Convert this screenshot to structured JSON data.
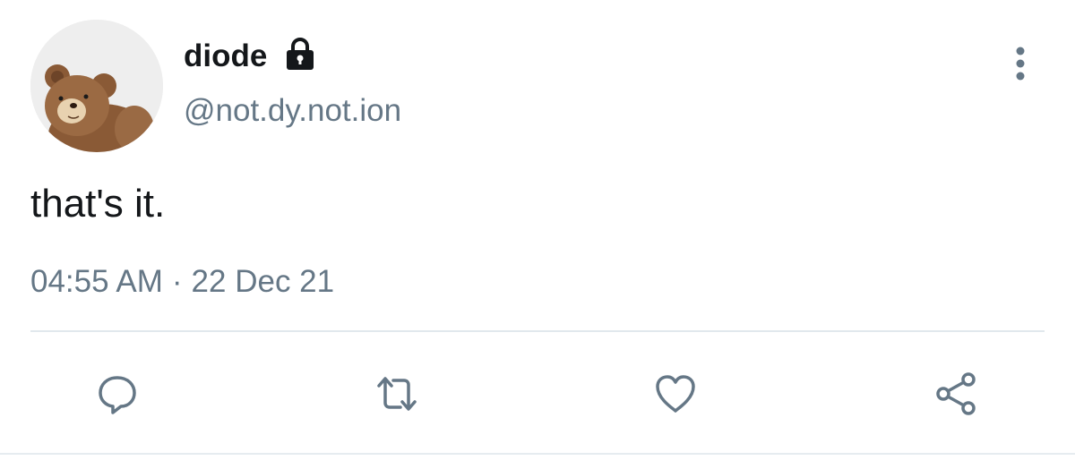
{
  "tweet": {
    "display_name": "diode",
    "handle": "@not.dy.not.ion",
    "protected_icon": "lock-icon",
    "text": "that's it.",
    "time": "04:55 AM",
    "separator": "·",
    "date": "22 Dec 21",
    "avatar_icon": "teddy-bear-avatar"
  },
  "actions": {
    "reply_icon": "reply-icon",
    "retweet_icon": "retweet-icon",
    "like_icon": "heart-icon",
    "share_icon": "share-icon",
    "more_icon": "more-options-icon"
  },
  "colors": {
    "primary_text": "#14171a",
    "secondary_text": "#657786",
    "icon": "#657786",
    "divider": "#e1e8ed"
  }
}
